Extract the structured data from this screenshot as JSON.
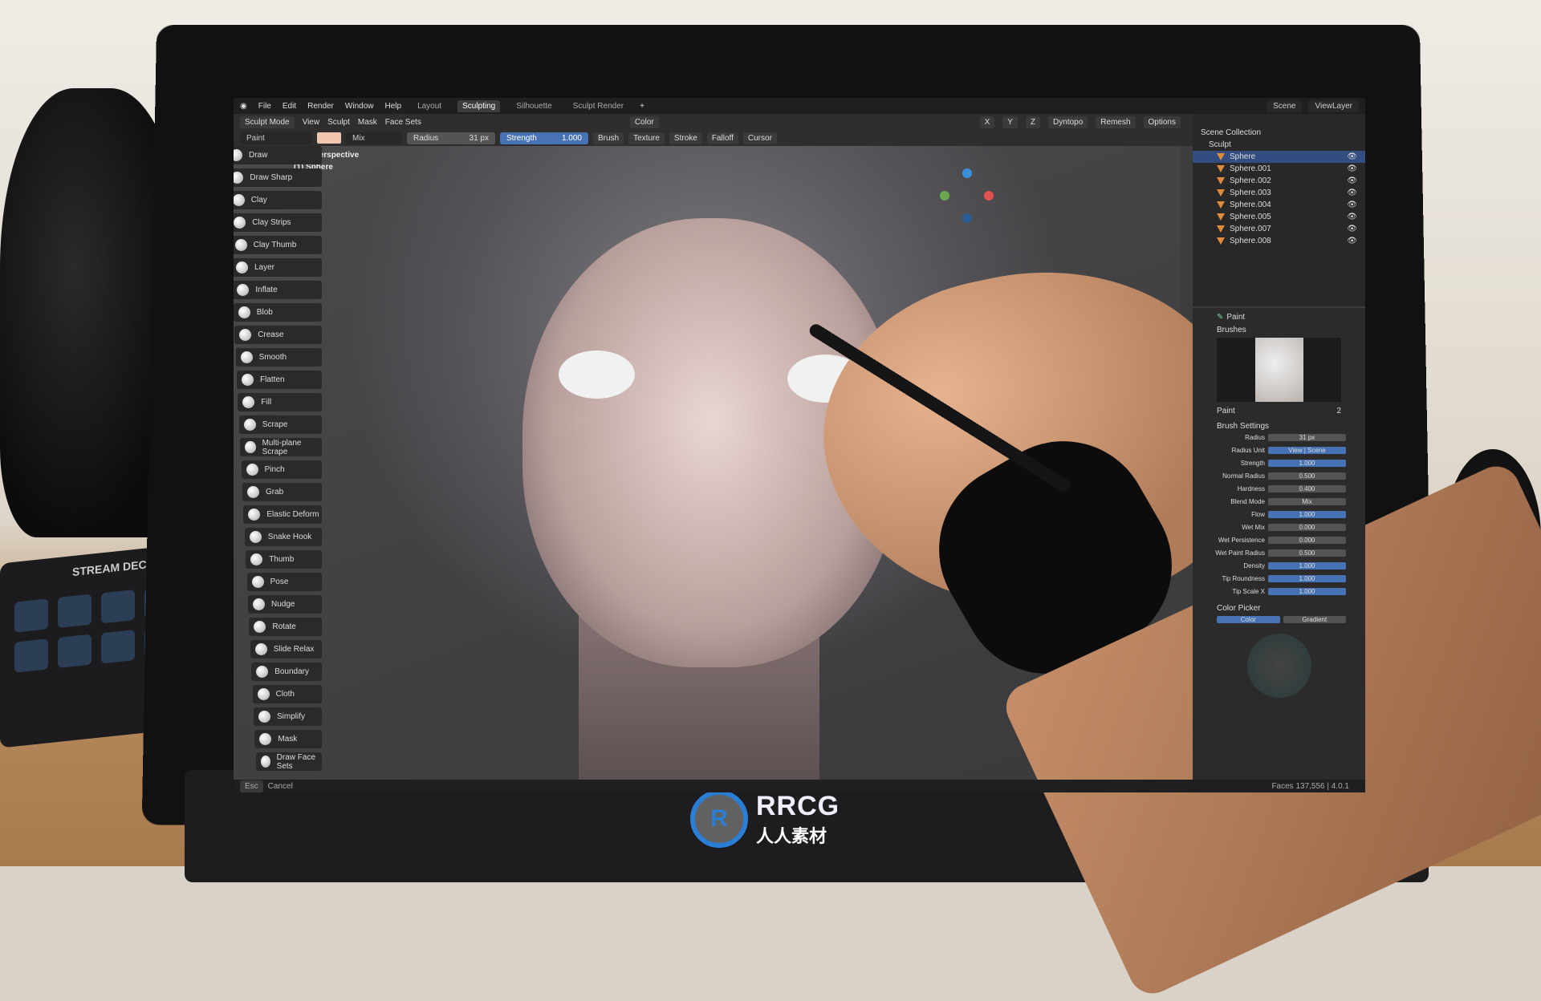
{
  "menu": {
    "items": [
      "File",
      "Edit",
      "Render",
      "Window",
      "Help"
    ],
    "workspaces": [
      "Layout",
      "Sculpting",
      "Silhouette",
      "Sculpt Render"
    ],
    "active_workspace": "Sculpting",
    "add": "+",
    "scene": "Scene",
    "view_layer": "ViewLayer"
  },
  "header": {
    "mode": "Sculpt Mode",
    "menus": [
      "View",
      "Sculpt",
      "Mask",
      "Face Sets"
    ],
    "color_mode": "Color"
  },
  "tool_settings": {
    "brush": "Paint",
    "blend": "Mix",
    "radius_label": "Radius",
    "radius_value": "31 px",
    "strength_label": "Strength",
    "strength_value": "1.000",
    "dropdowns": [
      "Brush",
      "Texture",
      "Stroke",
      "Falloff",
      "Cursor"
    ],
    "color": "#f3c6b1"
  },
  "viewport_header": {
    "axes": [
      "X",
      "Y",
      "Z"
    ],
    "dyntopo": "Dyntopo",
    "remesh": "Remesh",
    "options": "Options"
  },
  "overlay": {
    "perspective": "User Perspective",
    "object": "(1) Sphere"
  },
  "tools": [
    "Draw",
    "Draw Sharp",
    "Clay",
    "Clay Strips",
    "Clay Thumb",
    "Layer",
    "Inflate",
    "Blob",
    "Crease",
    "Smooth",
    "Flatten",
    "Fill",
    "Scrape",
    "Multi-plane Scrape",
    "Pinch",
    "Grab",
    "Elastic Deform",
    "Snake Hook",
    "Thumb",
    "Pose",
    "Nudge",
    "Rotate",
    "Slide Relax",
    "Boundary",
    "Cloth",
    "Simplify",
    "Mask",
    "Draw Face Sets"
  ],
  "outliner": {
    "root": "Scene Collection",
    "collection": "Sculpt",
    "objects": [
      "Sphere",
      "Sphere.001",
      "Sphere.002",
      "Sphere.003",
      "Sphere.004",
      "Sphere.005",
      "Sphere.007",
      "Sphere.008"
    ],
    "selected": "Sphere"
  },
  "properties": {
    "brush_name": "Paint",
    "brushes_panel": "Brushes",
    "brush_users": "2",
    "brush_settings_panel": "Brush Settings",
    "rows": [
      {
        "label": "Radius",
        "value": "31 px",
        "blue": false
      },
      {
        "label": "Radius Unit",
        "value": "View | Scene",
        "blue": true
      },
      {
        "label": "Strength",
        "value": "1.000",
        "blue": true
      },
      {
        "label": "Normal Radius",
        "value": "0.500",
        "blue": false
      },
      {
        "label": "Hardness",
        "value": "0.400",
        "blue": false
      },
      {
        "label": "Blend Mode",
        "value": "Mix",
        "blue": false
      },
      {
        "label": "Flow",
        "value": "1.000",
        "blue": true
      },
      {
        "label": "Wet Mix",
        "value": "0.000",
        "blue": false
      },
      {
        "label": "Wet Persistence",
        "value": "0.000",
        "blue": false
      },
      {
        "label": "Wet Paint Radius",
        "value": "0.500",
        "blue": false
      },
      {
        "label": "Density",
        "value": "1.000",
        "blue": true
      },
      {
        "label": "Tip Roundness",
        "value": "1.000",
        "blue": true
      },
      {
        "label": "Tip Scale X",
        "value": "1.000",
        "blue": true
      }
    ],
    "color_picker": "Color Picker",
    "picker_tabs": [
      "Color",
      "Gradient"
    ]
  },
  "status": {
    "key": "Esc",
    "action": "Cancel",
    "stats": "Faces 137,556 | 4.0.1"
  },
  "desk": {
    "stream_deck": "STREAM DECK"
  },
  "watermark": {
    "brand": "RRCG",
    "sub": "人人素材"
  }
}
